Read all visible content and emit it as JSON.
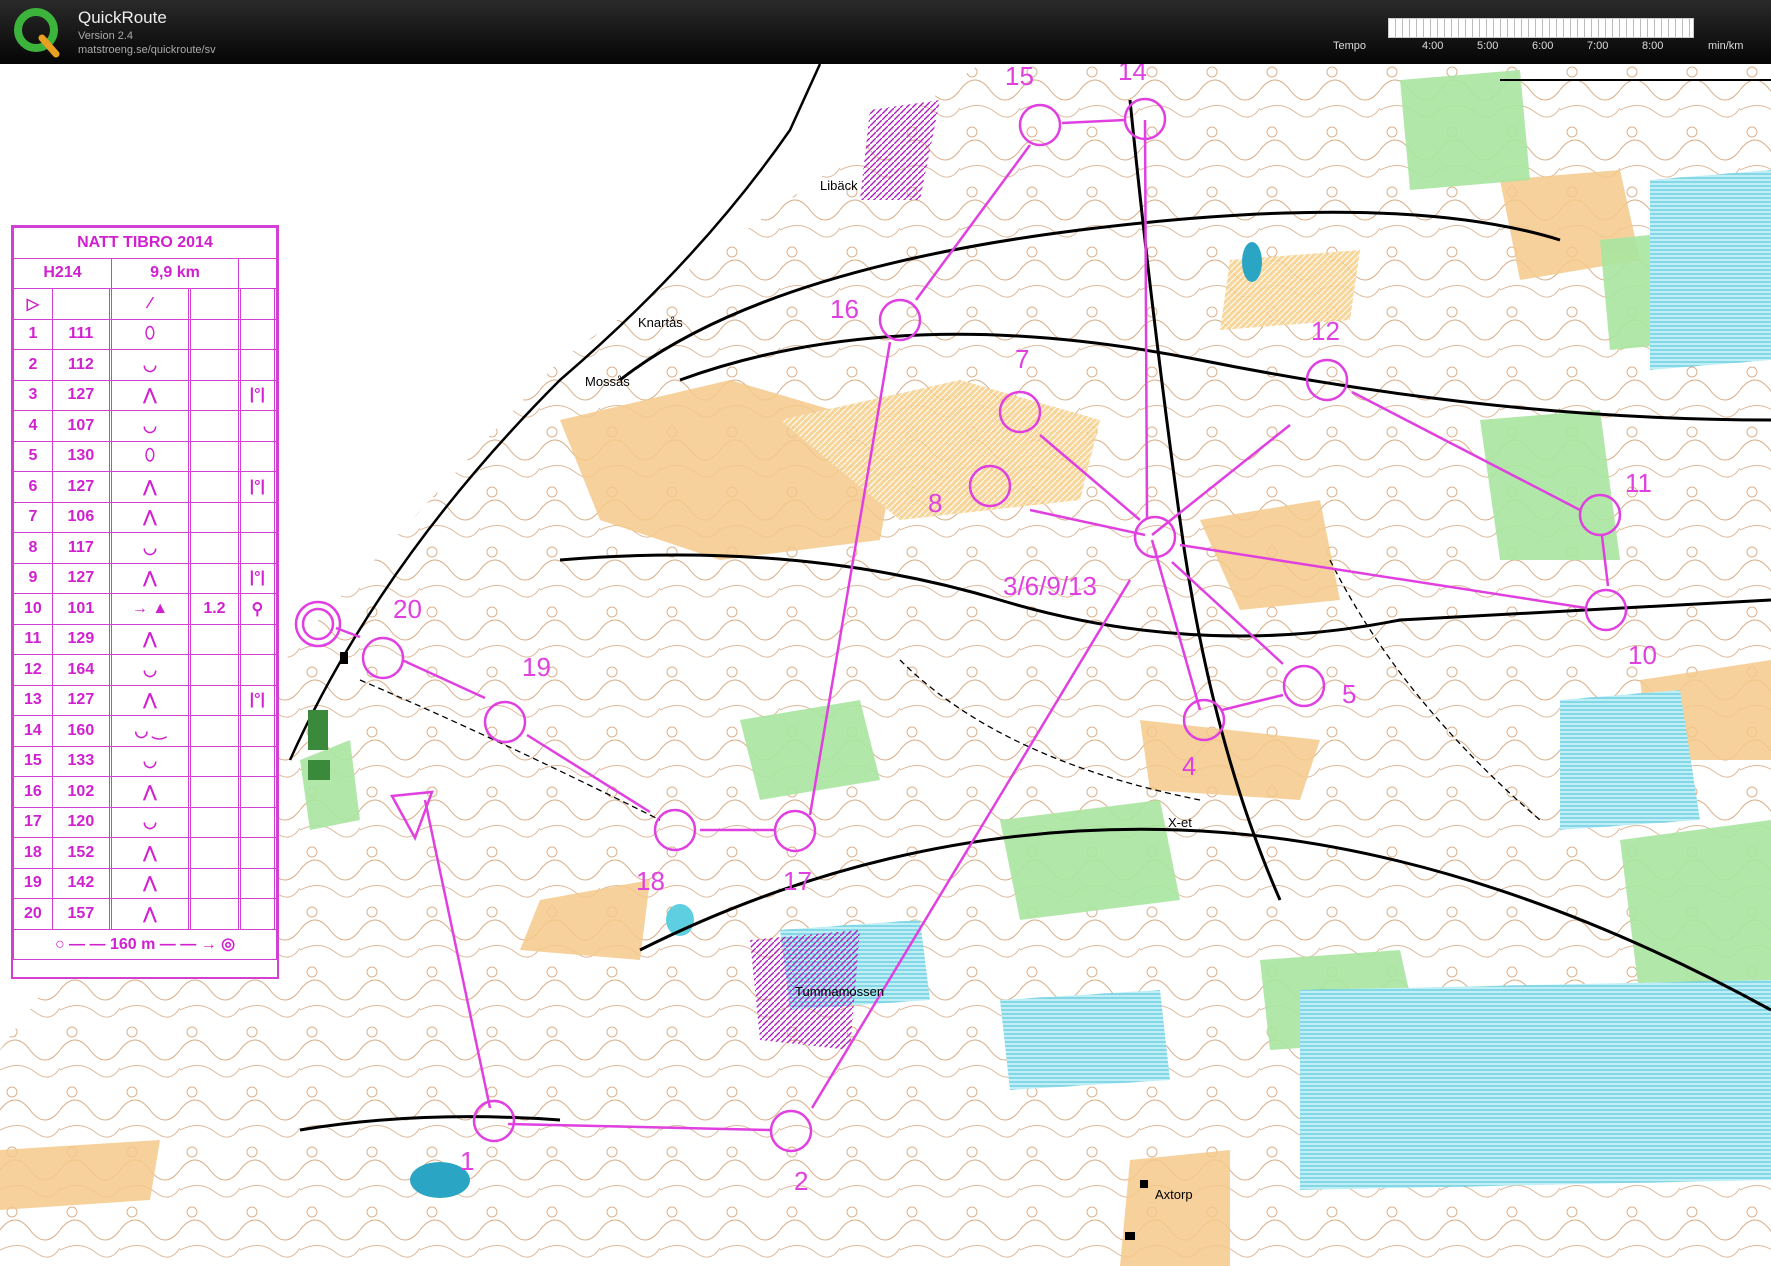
{
  "app": {
    "name": "QuickRoute",
    "version": "Version 2.4",
    "url": "matstroeng.se/quickroute/sv"
  },
  "tempo": {
    "label": "Tempo",
    "ticks": [
      "4:00",
      "5:00",
      "6:00",
      "7:00",
      "8:00"
    ],
    "unit": "min/km"
  },
  "legend": {
    "title": "NATT TIBRO 2014",
    "course": "H214",
    "length": "9,9 km",
    "controls": [
      {
        "n": "1",
        "code": "111",
        "sym": "⬯"
      },
      {
        "n": "2",
        "code": "112",
        "sym": "◡"
      },
      {
        "n": "3",
        "code": "127",
        "sym": "⋀",
        "extra": "|°|"
      },
      {
        "n": "4",
        "code": "107",
        "sym": "◡"
      },
      {
        "n": "5",
        "code": "130",
        "sym": "⬯"
      },
      {
        "n": "6",
        "code": "127",
        "sym": "⋀",
        "extra": "|°|"
      },
      {
        "n": "7",
        "code": "106",
        "sym": "⋀"
      },
      {
        "n": "8",
        "code": "117",
        "sym": "◡"
      },
      {
        "n": "9",
        "code": "127",
        "sym": "⋀",
        "extra": "|°|"
      },
      {
        "n": "10",
        "code": "101",
        "sym": "→ ▲",
        "dist": "1.2",
        "extra": "⚲"
      },
      {
        "n": "11",
        "code": "129",
        "sym": "⋀"
      },
      {
        "n": "12",
        "code": "164",
        "sym": "◡"
      },
      {
        "n": "13",
        "code": "127",
        "sym": "⋀",
        "extra": "|°|"
      },
      {
        "n": "14",
        "code": "160",
        "sym": "◡ ‿"
      },
      {
        "n": "15",
        "code": "133",
        "sym": "◡"
      },
      {
        "n": "16",
        "code": "102",
        "sym": "⋀"
      },
      {
        "n": "17",
        "code": "120",
        "sym": "◡"
      },
      {
        "n": "18",
        "code": "152",
        "sym": "⋀"
      },
      {
        "n": "19",
        "code": "142",
        "sym": "⋀"
      },
      {
        "n": "20",
        "code": "157",
        "sym": "⋀"
      }
    ],
    "finish": "160 m"
  },
  "places": [
    "Libäck",
    "Knartås",
    "Mossås",
    "Tummamossen",
    "Axtorp",
    "X-et"
  ],
  "control_labels": [
    "15",
    "14",
    "16",
    "12",
    "7",
    "8",
    "11",
    "3/6/9/13",
    "10",
    "20",
    "19",
    "5",
    "4",
    "18",
    "17",
    "1",
    "2"
  ],
  "colors": {
    "course": "#e040e0",
    "forest": "#ffffff",
    "open": "#f5c98a",
    "green": "#9fe09f",
    "water": "#7fd6e6",
    "contour": "#b5651d"
  }
}
